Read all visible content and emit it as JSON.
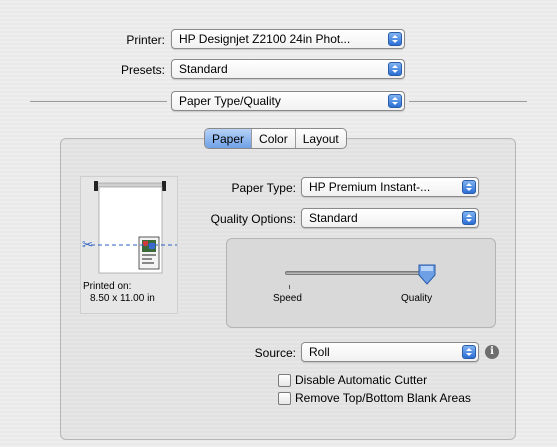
{
  "printer": {
    "label": "Printer:",
    "value": "HP Designjet Z2100 24in Phot..."
  },
  "presets": {
    "label": "Presets:",
    "value": "Standard"
  },
  "section": {
    "value": "Paper Type/Quality"
  },
  "tabs": [
    {
      "label": "Paper",
      "selected": true
    },
    {
      "label": "Color",
      "selected": false
    },
    {
      "label": "Layout",
      "selected": false
    }
  ],
  "preview": {
    "printed_on_label": "Printed on:",
    "size": "8.50 x 11.00 in"
  },
  "paper_type": {
    "label": "Paper Type:",
    "value": "HP Premium Instant-..."
  },
  "quality_options": {
    "label": "Quality Options:",
    "value": "Standard"
  },
  "quality_slider": {
    "left_label": "Speed",
    "right_label": "Quality",
    "level": 1.0
  },
  "source": {
    "label": "Source:",
    "value": "Roll"
  },
  "checkboxes": [
    {
      "label": "Disable Automatic Cutter",
      "checked": false
    },
    {
      "label": "Remove Top/Bottom Blank Areas",
      "checked": false
    }
  ],
  "icons": {
    "info": "info-icon",
    "scissors": "scissors-icon",
    "popup_arrows": "chevron-updown-icon"
  },
  "colors": {
    "accent": "#2b6fd6",
    "tab_selected": "#8fb8ee"
  }
}
